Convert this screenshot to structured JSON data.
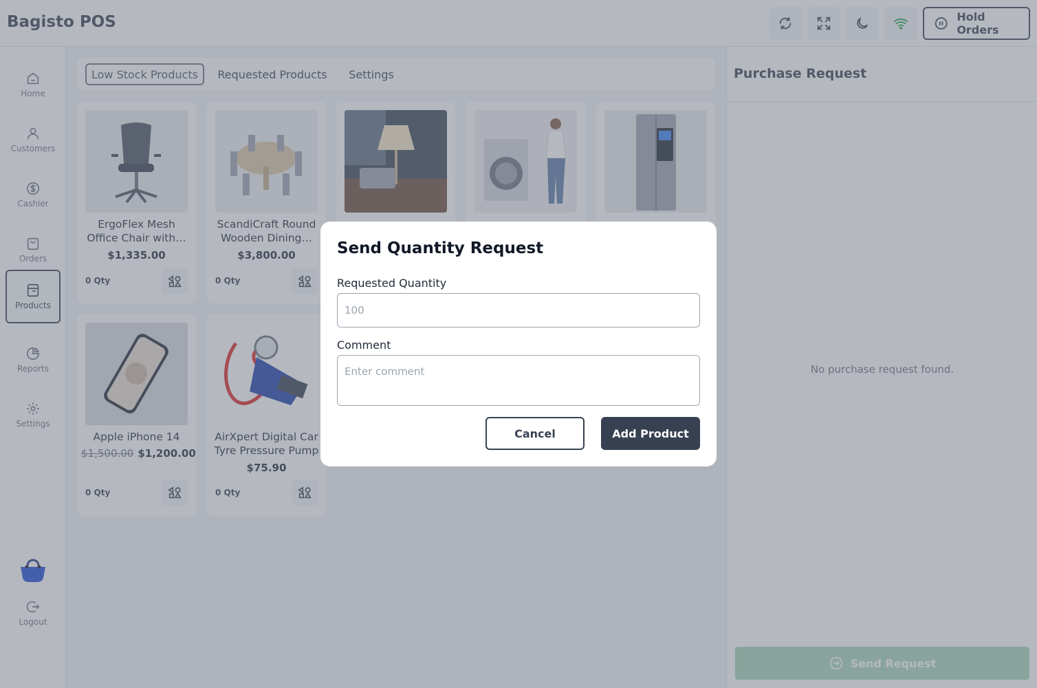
{
  "app": {
    "title": "Bagisto POS"
  },
  "topbar": {
    "buttons": [
      {
        "name": "refresh-icon"
      },
      {
        "name": "fullscreen-icon"
      },
      {
        "name": "dark-mode-icon"
      },
      {
        "name": "wifi-icon"
      }
    ],
    "hold_orders_label": "Hold Orders"
  },
  "sidebar": {
    "items": [
      {
        "label": "Home",
        "icon": "home-icon"
      },
      {
        "label": "Customers",
        "icon": "user-icon"
      },
      {
        "label": "Cashier",
        "icon": "dollar-icon"
      },
      {
        "label": "Orders",
        "icon": "bag-icon"
      },
      {
        "label": "Products",
        "icon": "box-icon",
        "active": true
      },
      {
        "label": "Reports",
        "icon": "pie-chart-icon"
      },
      {
        "label": "Settings",
        "icon": "gear-icon"
      }
    ],
    "logout_label": "Logout"
  },
  "tabs": [
    {
      "label": "Low Stock Products",
      "active": true
    },
    {
      "label": "Requested Products"
    },
    {
      "label": "Settings"
    }
  ],
  "products": [
    {
      "name": "ErgoFlex Mesh Office Chair with…",
      "price": "$1,335.00",
      "qty": "0 Qty",
      "image": "office-chair"
    },
    {
      "name": "ScandiCraft Round Wooden Dining…",
      "price": "$3,800.00",
      "qty": "0 Qty",
      "image": "dining-table"
    },
    {
      "name": "",
      "price": "",
      "qty": "",
      "image": "lamp"
    },
    {
      "name": "",
      "price": "",
      "qty": "",
      "image": "washing-machine"
    },
    {
      "name": "",
      "price": "",
      "qty": "",
      "image": "fridge"
    },
    {
      "name": "Apple iPhone 14",
      "old_price": "$1,500.00",
      "price": "$1,200.00",
      "qty": "0 Qty",
      "image": "iphone"
    },
    {
      "name": "AirXpert Digital Car Tyre Pressure Pump",
      "price": "$75.90",
      "qty": "0 Qty",
      "image": "air-pump"
    }
  ],
  "purchase_panel": {
    "title": "Purchase Request",
    "empty_text": "No purchase request found.",
    "send_label": "Send Request"
  },
  "modal": {
    "title": "Send Quantity Request",
    "quantity_label": "Requested Quantity",
    "quantity_placeholder": "100",
    "comment_label": "Comment",
    "comment_placeholder": "Enter comment",
    "cancel_label": "Cancel",
    "add_label": "Add Product"
  },
  "colors": {
    "primary": "#374151",
    "wifi": "#16a34a",
    "send_button": "#a7d7b8",
    "basket": "#1d4ed8"
  }
}
